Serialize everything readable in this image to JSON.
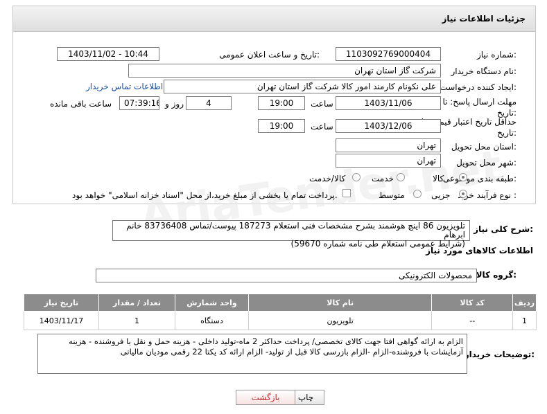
{
  "header": {
    "title": "جزئیات اطلاعات نیاز"
  },
  "form": {
    "need_number_label": "شماره نیاز:",
    "need_number": "1103092769000404",
    "announce_label": "تاریخ و ساعت اعلان عمومی:",
    "announce_value": "1403/11/02 - 10:44",
    "buyer_org_label": "نام دستگاه خریدار:",
    "buyer_org": "شرکت گاز استان تهران",
    "creator_label": "ایجاد کننده درخواست:",
    "creator": "علی نکونام کارمند امور کالا شرکت گاز استان تهران",
    "contact_link": "اطلاعات تماس خریدار",
    "deadline_label": "مهلت ارسال پاسخ: تا تاریخ:",
    "deadline_date": "1403/11/06",
    "time_label": "ساعت",
    "deadline_time": "19:00",
    "days_value": "4",
    "days_label": "روز و",
    "remaining_time": "07:39:16",
    "remaining_label": "ساعت باقی مانده",
    "validity_label": "حداقل تاریخ اعتبار قیمت: تا تاریخ:",
    "validity_date": "1403/12/06",
    "validity_time": "19:00",
    "province_label": "استان محل تحویل:",
    "province": "تهران",
    "city_label": "شهر محل تحویل:",
    "city": "تهران",
    "category_label": "طبقه بندی موضوعی:",
    "category_options": [
      "کالا",
      "خدمت",
      "کالا/خدمت"
    ],
    "process_label": "نوع فرآیند خرید :",
    "process_options": [
      "جزیی",
      "متوسط"
    ],
    "payment_note": "پرداخت تمام یا بخشی از مبلغ خرید،از محل \"اسناد خزانه اسلامی\" خواهد بود."
  },
  "description": {
    "label": "شرح کلی نیاز:",
    "text_line1": "تلویزیون 86 اینچ هوشمند بشرح مشخصات فنی استعلام 187273 پیوست/تماس 83736408 خانم ابرهام",
    "text_line2": "(شرایط عمومی استعلام طی نامه شماره 59670)"
  },
  "goods": {
    "section_title": "اطلاعات کالاهای مورد نیاز",
    "group_label": "گروه کالا:",
    "group_value": "محصولات الکترونیکی",
    "columns": [
      "ردیف",
      "کد کالا",
      "نام کالا",
      "واحد شمارش",
      "تعداد / مقدار",
      "تاریخ نیاز"
    ],
    "rows": [
      [
        "1",
        "--",
        "تلویزیون",
        "دستگاه",
        "1",
        "1403/11/17"
      ]
    ]
  },
  "buyer_notes": {
    "label": "توضیحات خریدار:",
    "line1": "الزام به ارائه گواهی افتا جهت کالای تخصصی/ پرداخت حداکثر 2 ماه-تولید داخلی - هزینه حمل و نقل با فروشنده - هزینه",
    "line2": "آزمایشات با فروشنده-الزام  -الزام بازرسی کالا قبل از تولید- الزام ارائه کد یکتا 22 رقمی مودیان مالیاتی"
  },
  "buttons": {
    "print": "چاپ",
    "back": "بازگشت"
  },
  "watermark": "AriaTender.net"
}
